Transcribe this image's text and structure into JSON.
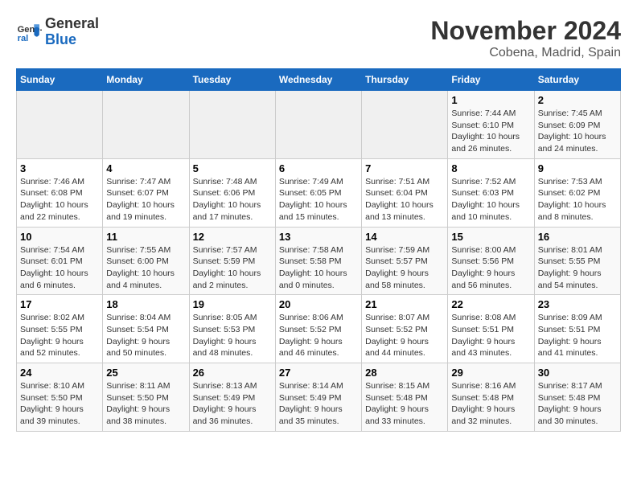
{
  "logo": {
    "line1": "General",
    "line2": "Blue"
  },
  "title": "November 2024",
  "location": "Cobena, Madrid, Spain",
  "days_of_week": [
    "Sunday",
    "Monday",
    "Tuesday",
    "Wednesday",
    "Thursday",
    "Friday",
    "Saturday"
  ],
  "weeks": [
    [
      {
        "day": "",
        "info": ""
      },
      {
        "day": "",
        "info": ""
      },
      {
        "day": "",
        "info": ""
      },
      {
        "day": "",
        "info": ""
      },
      {
        "day": "",
        "info": ""
      },
      {
        "day": "1",
        "info": "Sunrise: 7:44 AM\nSunset: 6:10 PM\nDaylight: 10 hours and 26 minutes."
      },
      {
        "day": "2",
        "info": "Sunrise: 7:45 AM\nSunset: 6:09 PM\nDaylight: 10 hours and 24 minutes."
      }
    ],
    [
      {
        "day": "3",
        "info": "Sunrise: 7:46 AM\nSunset: 6:08 PM\nDaylight: 10 hours and 22 minutes."
      },
      {
        "day": "4",
        "info": "Sunrise: 7:47 AM\nSunset: 6:07 PM\nDaylight: 10 hours and 19 minutes."
      },
      {
        "day": "5",
        "info": "Sunrise: 7:48 AM\nSunset: 6:06 PM\nDaylight: 10 hours and 17 minutes."
      },
      {
        "day": "6",
        "info": "Sunrise: 7:49 AM\nSunset: 6:05 PM\nDaylight: 10 hours and 15 minutes."
      },
      {
        "day": "7",
        "info": "Sunrise: 7:51 AM\nSunset: 6:04 PM\nDaylight: 10 hours and 13 minutes."
      },
      {
        "day": "8",
        "info": "Sunrise: 7:52 AM\nSunset: 6:03 PM\nDaylight: 10 hours and 10 minutes."
      },
      {
        "day": "9",
        "info": "Sunrise: 7:53 AM\nSunset: 6:02 PM\nDaylight: 10 hours and 8 minutes."
      }
    ],
    [
      {
        "day": "10",
        "info": "Sunrise: 7:54 AM\nSunset: 6:01 PM\nDaylight: 10 hours and 6 minutes."
      },
      {
        "day": "11",
        "info": "Sunrise: 7:55 AM\nSunset: 6:00 PM\nDaylight: 10 hours and 4 minutes."
      },
      {
        "day": "12",
        "info": "Sunrise: 7:57 AM\nSunset: 5:59 PM\nDaylight: 10 hours and 2 minutes."
      },
      {
        "day": "13",
        "info": "Sunrise: 7:58 AM\nSunset: 5:58 PM\nDaylight: 10 hours and 0 minutes."
      },
      {
        "day": "14",
        "info": "Sunrise: 7:59 AM\nSunset: 5:57 PM\nDaylight: 9 hours and 58 minutes."
      },
      {
        "day": "15",
        "info": "Sunrise: 8:00 AM\nSunset: 5:56 PM\nDaylight: 9 hours and 56 minutes."
      },
      {
        "day": "16",
        "info": "Sunrise: 8:01 AM\nSunset: 5:55 PM\nDaylight: 9 hours and 54 minutes."
      }
    ],
    [
      {
        "day": "17",
        "info": "Sunrise: 8:02 AM\nSunset: 5:55 PM\nDaylight: 9 hours and 52 minutes."
      },
      {
        "day": "18",
        "info": "Sunrise: 8:04 AM\nSunset: 5:54 PM\nDaylight: 9 hours and 50 minutes."
      },
      {
        "day": "19",
        "info": "Sunrise: 8:05 AM\nSunset: 5:53 PM\nDaylight: 9 hours and 48 minutes."
      },
      {
        "day": "20",
        "info": "Sunrise: 8:06 AM\nSunset: 5:52 PM\nDaylight: 9 hours and 46 minutes."
      },
      {
        "day": "21",
        "info": "Sunrise: 8:07 AM\nSunset: 5:52 PM\nDaylight: 9 hours and 44 minutes."
      },
      {
        "day": "22",
        "info": "Sunrise: 8:08 AM\nSunset: 5:51 PM\nDaylight: 9 hours and 43 minutes."
      },
      {
        "day": "23",
        "info": "Sunrise: 8:09 AM\nSunset: 5:51 PM\nDaylight: 9 hours and 41 minutes."
      }
    ],
    [
      {
        "day": "24",
        "info": "Sunrise: 8:10 AM\nSunset: 5:50 PM\nDaylight: 9 hours and 39 minutes."
      },
      {
        "day": "25",
        "info": "Sunrise: 8:11 AM\nSunset: 5:50 PM\nDaylight: 9 hours and 38 minutes."
      },
      {
        "day": "26",
        "info": "Sunrise: 8:13 AM\nSunset: 5:49 PM\nDaylight: 9 hours and 36 minutes."
      },
      {
        "day": "27",
        "info": "Sunrise: 8:14 AM\nSunset: 5:49 PM\nDaylight: 9 hours and 35 minutes."
      },
      {
        "day": "28",
        "info": "Sunrise: 8:15 AM\nSunset: 5:48 PM\nDaylight: 9 hours and 33 minutes."
      },
      {
        "day": "29",
        "info": "Sunrise: 8:16 AM\nSunset: 5:48 PM\nDaylight: 9 hours and 32 minutes."
      },
      {
        "day": "30",
        "info": "Sunrise: 8:17 AM\nSunset: 5:48 PM\nDaylight: 9 hours and 30 minutes."
      }
    ]
  ]
}
